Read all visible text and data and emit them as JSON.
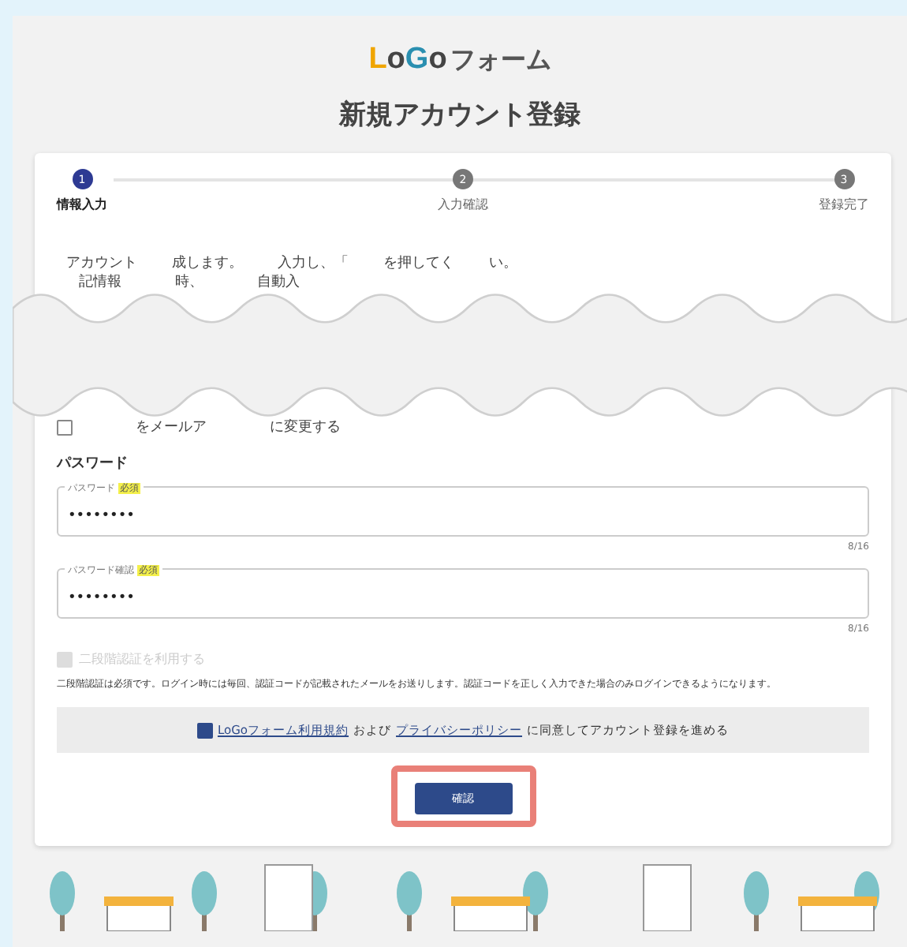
{
  "logo": {
    "letters": [
      {
        "text": "L",
        "color": "#f0a500"
      },
      {
        "text": "o",
        "color": "#444444"
      },
      {
        "text": "G",
        "color": "#2a8fb0"
      },
      {
        "text": "o",
        "color": "#444444"
      }
    ],
    "suffix": "フォーム"
  },
  "title": "新規アカウント登録",
  "steps": [
    {
      "number": "1",
      "label": "情報入力",
      "selected": true
    },
    {
      "number": "2",
      "label": "入力確認",
      "selected": false
    },
    {
      "number": "3",
      "label": "登録完了",
      "selected": false
    }
  ],
  "intro_fragments": [
    [
      "アカウント",
      "成します。",
      "入力し、「",
      "を押してく",
      "い。"
    ],
    [
      "記情報",
      "時、",
      "自動入"
    ]
  ],
  "email_option": {
    "checked": false,
    "fragments": [
      "をメールア",
      "に変更する"
    ]
  },
  "password_section": {
    "heading": "パスワード",
    "fields": [
      {
        "label": "パスワード",
        "badge": "必須",
        "value": "••••••••",
        "counter": "8/16"
      },
      {
        "label": "パスワード確認",
        "badge": "必須",
        "value": "••••••••",
        "counter": "8/16"
      }
    ]
  },
  "two_factor": {
    "label": "二段階認証を利用する",
    "checked": true,
    "disabled": true,
    "note": "二段階認証は必須です。ログイン時には毎回、認証コードが記載されたメールをお送りします。認証コードを正しく入力できた場合のみログインできるようになります。"
  },
  "agreement": {
    "checked": true,
    "terms_link": "LoGoフォーム利用規約",
    "and": "および",
    "privacy_link": "プライバシーポリシー",
    "rest": "に同意してアカウント登録を進める"
  },
  "confirm_button": {
    "label": "確認",
    "highlighted": true
  }
}
